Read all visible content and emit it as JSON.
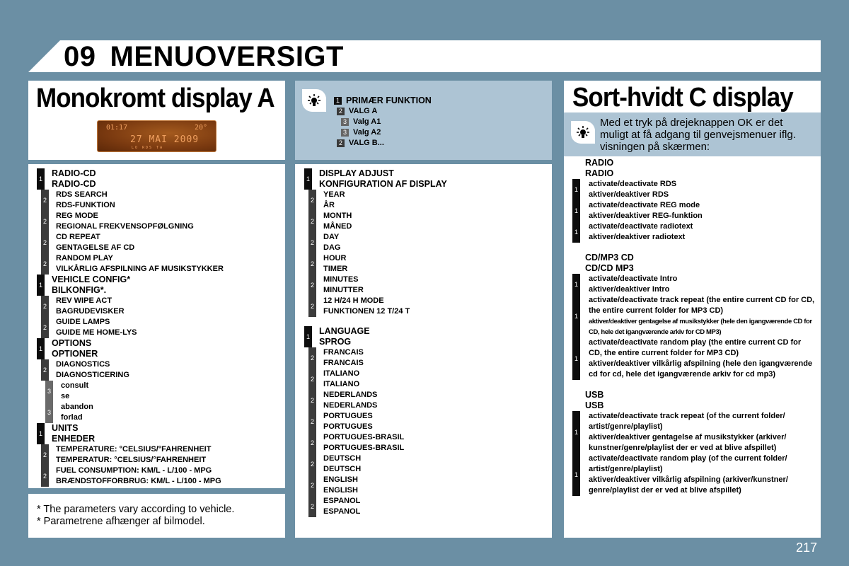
{
  "header": {
    "chapter": "09",
    "title": "MENUOVERSIGT"
  },
  "panel_a": {
    "title": "Monokromt display A",
    "lcd": {
      "time": "01:17",
      "temp": "20°",
      "date": "27 MAI 2009",
      "small": "LO   RDS  TA"
    }
  },
  "legend": {
    "lines": [
      {
        "level": "1",
        "text": "PRIMÆR FUNKTION"
      },
      {
        "level": "2",
        "text": "VALG A"
      },
      {
        "level": "3",
        "text": "Valg A1"
      },
      {
        "level": "3",
        "text": "Valg A2"
      },
      {
        "level": "2",
        "text": "VALG B..."
      }
    ]
  },
  "panel_c": {
    "title": "Sort-hvidt C display",
    "intro": "Med et tryk på drejeknappen OK er det muligt at få adgang til genvejsmenuer iflg. visningen på skærmen:"
  },
  "menu_a": [
    {
      "level": "1",
      "en": "RADIO-CD",
      "da": "RADIO-CD"
    },
    {
      "level": "2",
      "en": "RDS SEARCH",
      "da": "RDS-FUNKTION"
    },
    {
      "level": "2",
      "en": "REG MODE",
      "da": "REGIONAL FREKVENSOPFØLGNING"
    },
    {
      "level": "2",
      "en": "CD REPEAT",
      "da": "GENTAGELSE AF CD"
    },
    {
      "level": "2",
      "en": "RANDOM PLAY",
      "da": "VILKÅRLIG AFSPILNING AF MUSIKSTYKKER"
    },
    {
      "level": "1",
      "en": "VEHICLE CONFIG*",
      "da": "BILKONFIG*."
    },
    {
      "level": "2",
      "en": "REV WIPE ACT",
      "da": "BAGRUDEVISKER"
    },
    {
      "level": "2",
      "en": "GUIDE LAMPS",
      "da": "GUIDE ME HOME-LYS"
    },
    {
      "level": "1",
      "en": "OPTIONS",
      "da": "OPTIONER"
    },
    {
      "level": "2",
      "en": "DIAGNOSTICS",
      "da": "DIAGNOSTICERING"
    },
    {
      "level": "3",
      "en": "consult",
      "da": "se"
    },
    {
      "level": "3",
      "en": "abandon",
      "da": "forlad"
    },
    {
      "level": "1",
      "en": "UNITS",
      "da": "ENHEDER"
    },
    {
      "level": "2",
      "en": "TEMPERATURE: °CELSIUS/°FAHRENHEIT",
      "da": "TEMPERATUR: °CELSIUS/°FAHRENHEIT"
    },
    {
      "level": "2",
      "en": "FUEL CONSUMPTION: KM/L - L/100 - MPG",
      "da": "BRÆNDSTOFFORBRUG: KM/L - L/100 - MPG"
    }
  ],
  "footnotes": [
    "* The parameters vary according to vehicle.",
    "* Parametrene afhænger af bilmodel."
  ],
  "menu_display": [
    {
      "level": "1",
      "en": "DISPLAY ADJUST",
      "da": "KONFIGURATION AF DISPLAY"
    },
    {
      "level": "2",
      "en": "YEAR",
      "da": "ÅR"
    },
    {
      "level": "2",
      "en": "MONTH",
      "da": "MÅNED"
    },
    {
      "level": "2",
      "en": "DAY",
      "da": "DAG"
    },
    {
      "level": "2",
      "en": "HOUR",
      "da": "TIMER"
    },
    {
      "level": "2",
      "en": "MINUTES",
      "da": "MINUTTER"
    },
    {
      "level": "2",
      "en": "12 H/24 H MODE",
      "da": "FUNKTIONEN 12 T/24 T"
    }
  ],
  "menu_language": [
    {
      "level": "1",
      "en": "LANGUAGE",
      "da": "SPROG"
    },
    {
      "level": "2",
      "en": "FRANCAIS",
      "da": "FRANCAIS"
    },
    {
      "level": "2",
      "en": "ITALIANO",
      "da": "ITALIANO"
    },
    {
      "level": "2",
      "en": "NEDERLANDS",
      "da": "NEDERLANDS"
    },
    {
      "level": "2",
      "en": "PORTUGUES",
      "da": "PORTUGUES"
    },
    {
      "level": "2",
      "en": "PORTUGUES-BRASIL",
      "da": "PORTUGUES-BRASIL"
    },
    {
      "level": "2",
      "en": "DEUTSCH",
      "da": "DEUTSCH"
    },
    {
      "level": "2",
      "en": "ENGLISH",
      "da": "ENGLISH"
    },
    {
      "level": "2",
      "en": "ESPANOL",
      "da": "ESPANOL"
    }
  ],
  "sections_c": [
    {
      "title_en": "RADIO",
      "title_da": "RADIO",
      "items": [
        {
          "level": "1",
          "en": "activate/deactivate RDS",
          "da": "aktiver/deaktiver RDS"
        },
        {
          "level": "1",
          "en": "activate/deactivate REG mode",
          "da": "aktiver/deaktiver REG-funktion"
        },
        {
          "level": "1",
          "en": "activate/deactivate radiotext",
          "da": "aktiver/deaktiver radiotext"
        }
      ]
    },
    {
      "title_en": "CD/MP3 CD",
      "title_da": "CD/CD MP3",
      "items": [
        {
          "level": "1",
          "en": "activate/deactivate Intro",
          "da": "aktiver/deaktiver Intro"
        },
        {
          "level": "1",
          "en": "activate/deactivate track repeat (the entire current CD for CD, the entire current folder for MP3 CD)",
          "da": "aktiver/deaktiver gentagelse af musikstykker (hele den igangværende CD for CD, hele det igangværende arkiv for CD MP3)",
          "da_condensed": true
        },
        {
          "level": "1",
          "en": "activate/deactivate random play (the entire current CD for CD, the entire current folder for MP3 CD)",
          "da": "aktiver/deaktiver vilkårlig afspilning (hele den igangværende cd for cd, hele det igangværende arkiv for cd mp3)"
        }
      ]
    },
    {
      "title_en": "USB",
      "title_da": "USB",
      "items": [
        {
          "level": "1",
          "en": "activate/deactivate track repeat (of the current folder/ artist/genre/playlist)",
          "da": "aktiver/deaktiver gentagelse af musikstykker (arkiver/ kunstner/genre/playlist der er ved at blive afspillet)"
        },
        {
          "level": "1",
          "en": "activate/deactivate random play (of the current folder/ artist/genre/playlist)",
          "da": "aktiver/deaktiver vilkårlig afspilning (arkiver/kunstner/ genre/playlist der er ved at blive afspillet)"
        }
      ]
    }
  ],
  "page_number": "217"
}
